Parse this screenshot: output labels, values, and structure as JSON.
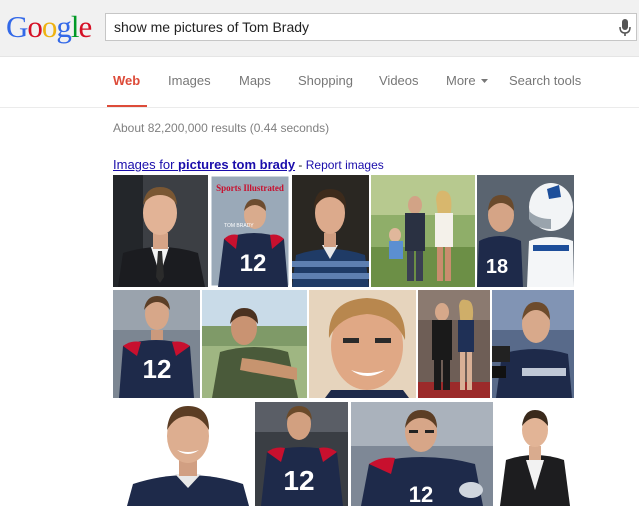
{
  "logo": {
    "letters": [
      "G",
      "o",
      "o",
      "g",
      "l",
      "e"
    ],
    "colors": [
      "#3369e8",
      "#d50f25",
      "#eeb211",
      "#3369e8",
      "#009925",
      "#d50f25"
    ]
  },
  "search": {
    "query": "show me pictures of Tom Brady"
  },
  "nav": {
    "tabs": [
      "Web",
      "Images",
      "Maps",
      "Shopping",
      "Videos",
      "More",
      "Search tools"
    ],
    "active": "Web"
  },
  "results": {
    "stats": "About 82,200,000 results (0.44 seconds)"
  },
  "images_section": {
    "prefix": "Images for ",
    "query": "pictures tom brady",
    "separator": " - ",
    "report_label": "Report images"
  },
  "thumbnails": {
    "sports_illustrated": {
      "masthead": "Sports Illustrated",
      "jersey_number": "12",
      "caption": "TOM BRADY"
    },
    "jersey_numbers": [
      "12",
      "12",
      "12",
      "18"
    ]
  },
  "colors": {
    "accent_red": "#dd4b39",
    "link_blue": "#1a0dab",
    "patriots_navy": "#1e2a4a"
  }
}
